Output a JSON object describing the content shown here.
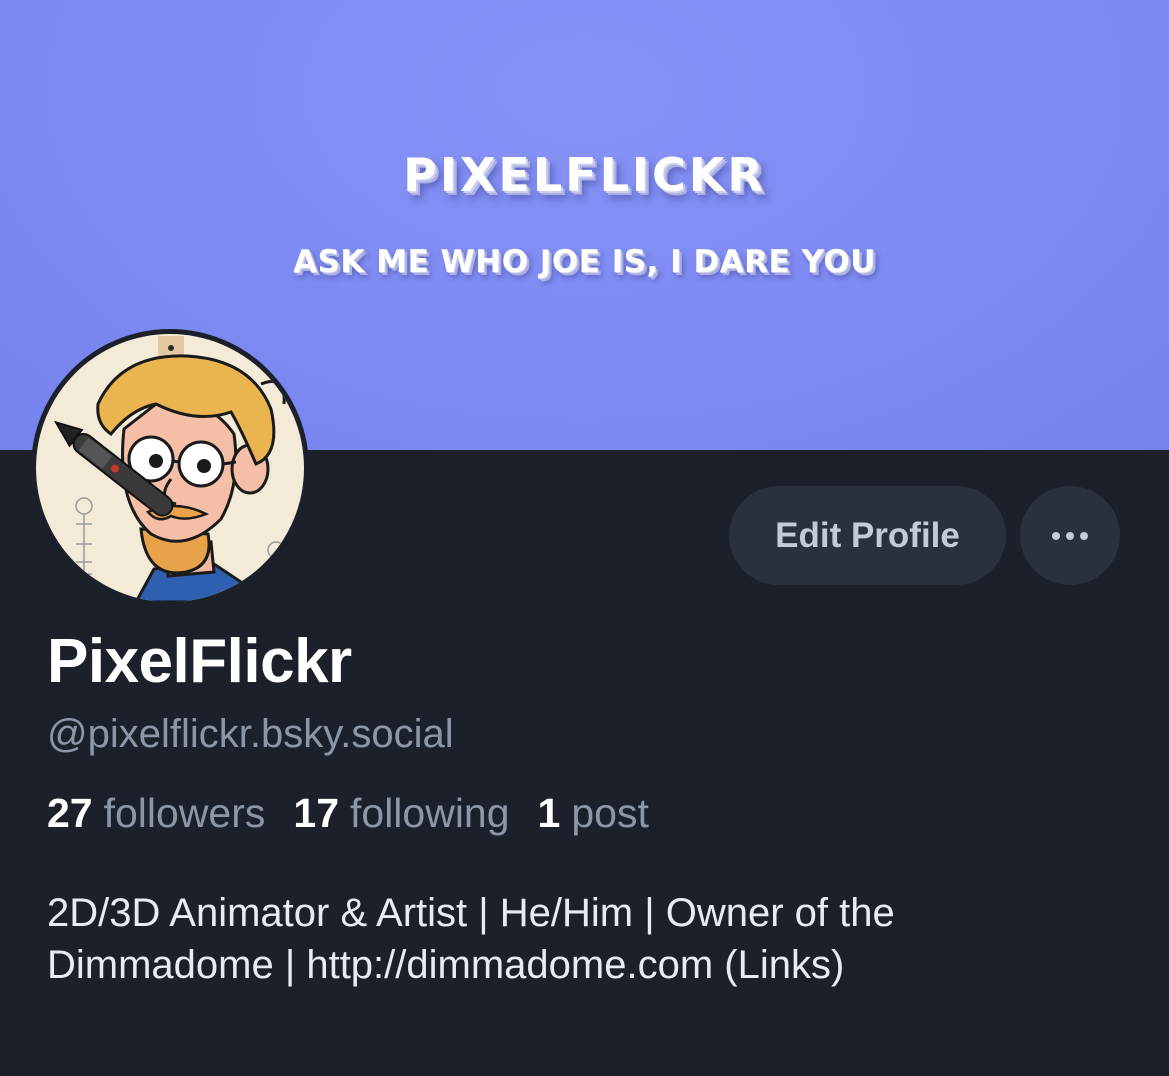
{
  "banner": {
    "title": "PIXELFLICKR",
    "subtitle": "ASK ME WHO JOE IS, I DARE YOU"
  },
  "profile": {
    "avatar_icon": "avatar-illustration",
    "display_name": "PixelFlickr",
    "handle": "@pixelflickr.bsky.social",
    "edit_button_label": "Edit Profile",
    "more_button_icon": "ellipsis-icon",
    "stats": [
      {
        "count": "27",
        "label": "followers"
      },
      {
        "count": "17",
        "label": "following"
      },
      {
        "count": "1",
        "label": "post"
      }
    ],
    "bio_line1": "2D/3D Animator & Artist | He/Him | Owner of the",
    "bio_line2": "Dimmadome | http://dimmadome.com (Links)"
  },
  "colors": {
    "banner": "#7f8cf3",
    "background": "#1b202b",
    "button_bg": "#2a303c",
    "muted_text": "#8c96a6"
  }
}
